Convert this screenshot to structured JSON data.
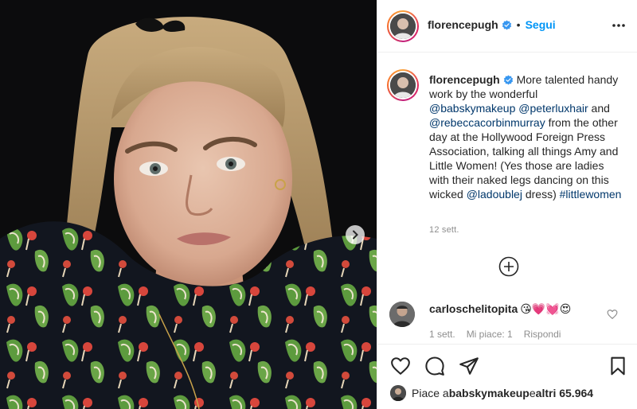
{
  "post": {
    "username": "florencepugh",
    "follow_label": "Segui",
    "separator": "•"
  },
  "caption": {
    "username": "florencepugh",
    "t1": "More talented handy work by the wonderful ",
    "m1": "@babskymakeup",
    "t2": " ",
    "m2": "@peterluxhair",
    "t3": " and ",
    "m3": "@rebeccacorbinmurray",
    "t4": " from the other day at the Hollywood Foreign Press Association, talking all things Amy and Little Women! (Yes those are ladies with their naked legs dancing on this wicked ",
    "m4": "@ladoublej",
    "t5": " dress) ",
    "m5": "#littlewomen",
    "time": "12 sett."
  },
  "comment": {
    "username": "carloschelitopita",
    "emoji": "😘💗💓😍",
    "time": "1 sett.",
    "likes": "Mi piace: 1",
    "reply": "Rispondi"
  },
  "likes_line": {
    "prefix": "Piace a ",
    "user": "babskymakeup",
    "middle": " e ",
    "others": "altri 65.964"
  },
  "icons": {
    "verified": "verified-badge-icon",
    "more": "more-options-icon",
    "next": "chevron-right-icon",
    "load_more": "plus-circle-icon",
    "heart": "heart-outline-icon",
    "comment": "comment-bubble-icon",
    "share": "paper-plane-icon",
    "save": "bookmark-icon"
  },
  "colors": {
    "link": "#00376b",
    "follow": "#0095f6",
    "verified": "#3897f0",
    "muted": "#8e8e8e",
    "text": "#262626"
  }
}
